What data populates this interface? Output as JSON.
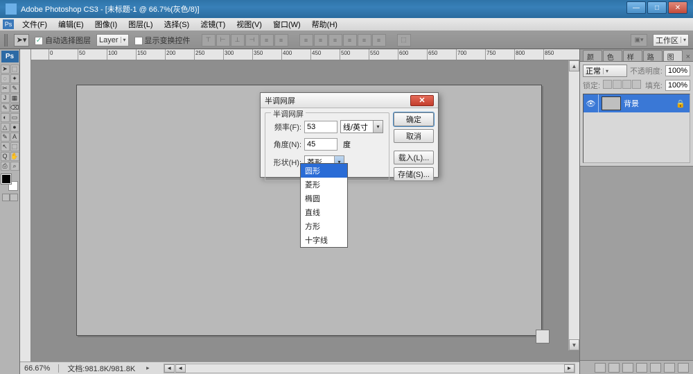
{
  "title": "Adobe Photoshop CS3 - [未标题-1 @ 66.7%(灰色/8)]",
  "win_btns": {
    "min": "—",
    "max": "□",
    "close": "✕"
  },
  "menu": [
    "文件(F)",
    "编辑(E)",
    "图像(I)",
    "图层(L)",
    "选择(S)",
    "滤镜(T)",
    "视图(V)",
    "窗口(W)",
    "帮助(H)"
  ],
  "options": {
    "auto_select": "自动选择图层",
    "layer_combo": "Layer",
    "show_transform": "显示变换控件",
    "workspace": "工作区"
  },
  "ruler_numbers": [
    "0",
    "50",
    "100",
    "150",
    "200",
    "250",
    "300",
    "350",
    "400",
    "450",
    "500",
    "550",
    "600",
    "650",
    "700",
    "750",
    "800",
    "850"
  ],
  "status": {
    "zoom": "66.67%",
    "doc": "文档:981.8K/981.8K"
  },
  "panel": {
    "tabs": [
      "颜色",
      "色板",
      "样式",
      "路径",
      "图层"
    ],
    "blend": "正常",
    "opacity_label": "不透明度:",
    "opacity": "100%",
    "lock_label": "锁定:",
    "fill_label": "填充:",
    "fill": "100%",
    "layer_name": "背景"
  },
  "dialog": {
    "title": "半调网屏",
    "group": "半调网屏",
    "freq_label": "频率(F):",
    "freq_val": "53",
    "freq_unit": "线/英寸",
    "angle_label": "角度(N):",
    "angle_val": "45",
    "angle_unit": "度",
    "shape_label": "形状(H):",
    "shape_val": "菱形",
    "btns": {
      "ok": "确定",
      "cancel": "取消",
      "load": "载入(L)...",
      "save": "存储(S)..."
    },
    "shape_options": [
      "圆形",
      "菱形",
      "椭圆",
      "直线",
      "方形",
      "十字线"
    ],
    "shape_selected_index": 0
  },
  "tool_glyphs": [
    [
      "➤",
      "⬚"
    ],
    [
      "◌",
      "✦"
    ],
    [
      "✂",
      "✎"
    ],
    [
      "J",
      "▦"
    ],
    [
      "✎",
      "⌫"
    ],
    [
      "◐",
      "▭"
    ],
    [
      "△",
      "●"
    ],
    [
      "✎",
      "A"
    ],
    [
      "↖",
      "⬚"
    ],
    [
      "Q",
      "✋"
    ],
    [
      "⎙",
      "⌕"
    ]
  ]
}
